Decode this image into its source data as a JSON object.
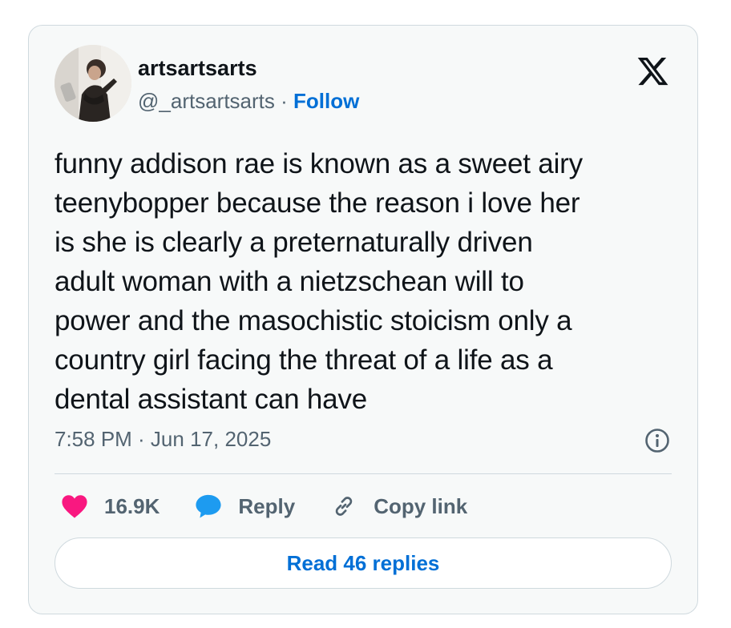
{
  "author": {
    "display_name": "artsartsarts",
    "handle": "@_artsartsarts",
    "separator": " · ",
    "follow_label": "Follow"
  },
  "tweet": {
    "text": "funny addison rae is known as a sweet airy\nteenybopper because the reason i love her\nis she is clearly a preternaturally driven\nadult woman with a nietzschean will to\npower and the masochistic stoicism only a\ncountry girl facing the threat of a life as a\ndental assistant can have",
    "timestamp": "7:58 PM · Jun 17, 2025"
  },
  "actions": {
    "like_count": "16.9K",
    "reply_label": "Reply",
    "copy_link_label": "Copy link"
  },
  "read_replies_label": "Read 46 replies",
  "colors": {
    "link_blue": "#006fd6",
    "like_pink": "#f91880",
    "reply_blue": "#1d9bf0",
    "secondary_text": "#536471",
    "card_bg": "#f7f9f9",
    "border": "#cfd9de"
  },
  "icons": {
    "platform": "x-logo-icon",
    "info": "info-icon",
    "like": "heart-icon",
    "reply": "speech-bubble-icon",
    "copy_link": "link-icon"
  }
}
